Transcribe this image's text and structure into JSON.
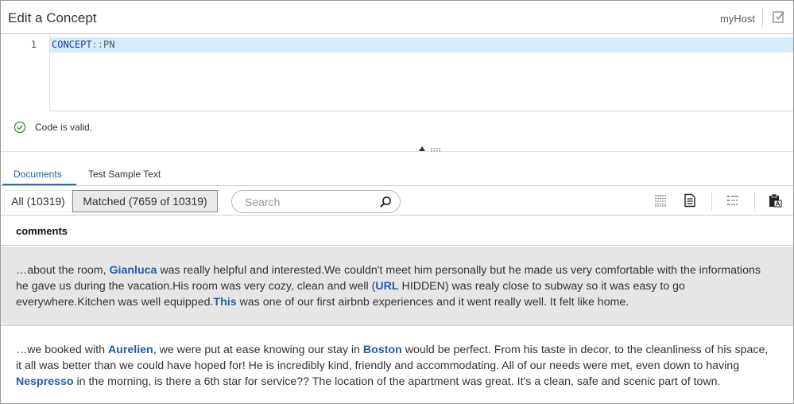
{
  "title": "Edit a Concept",
  "host": "myHost",
  "editor": {
    "line_number": "1",
    "code_keyword": "CONCEPT",
    "code_operator": "::",
    "code_name": "PN"
  },
  "validation": {
    "message": "Code is valid."
  },
  "tabs": [
    {
      "label": "Documents",
      "active": true
    },
    {
      "label": "Test Sample Text",
      "active": false
    }
  ],
  "filters": {
    "all_label": "All (10319)",
    "matched_label": "Matched (7659 of 10319)"
  },
  "search": {
    "placeholder": "Search",
    "value": ""
  },
  "toolbar_icons": [
    "list-view-icon",
    "document-view-icon",
    "annotated-list-icon",
    "clipboard-icon"
  ],
  "results": {
    "column_header": "comments",
    "rows": [
      {
        "selected": true,
        "segments": [
          {
            "text": "…about the room, ",
            "match": false
          },
          {
            "text": "Gianluca",
            "match": true
          },
          {
            "text": " was really helpful and interested.We couldn't meet him personally but he made us very comfortable with the informations he gave us during the vacation.His room was very cozy, clean and well (",
            "match": false
          },
          {
            "text": "URL",
            "match": true
          },
          {
            "text": " HIDDEN) was realy close to subway so it was easy to go everywhere.Kitchen was well equipped.",
            "match": false
          },
          {
            "text": "This",
            "match": true
          },
          {
            "text": " was one of our first airbnb experiences and it went really well. It felt like home.",
            "match": false
          }
        ]
      },
      {
        "selected": false,
        "segments": [
          {
            "text": "…we booked with ",
            "match": false
          },
          {
            "text": "Aurelien",
            "match": true
          },
          {
            "text": ", we were put at ease knowing our stay in ",
            "match": false
          },
          {
            "text": "Boston",
            "match": true
          },
          {
            "text": " would be perfect. From his taste in decor, to the cleanliness of his space, it all was better than we could have hoped for! He is incredibly kind, friendly and accommodating. All of our needs were met, even down to having ",
            "match": false
          },
          {
            "text": "Nespresso",
            "match": true
          },
          {
            "text": " in the morning, is there a 6th star for service?? The location of the apartment was great. It's a clean, safe and scenic part of town.",
            "match": false
          }
        ]
      }
    ]
  },
  "colors": {
    "accent": "#1f5fa8",
    "line_highlight": "#d7ecfb",
    "valid_green": "#3a8a3a",
    "selected_row": "#e6e6e6"
  }
}
